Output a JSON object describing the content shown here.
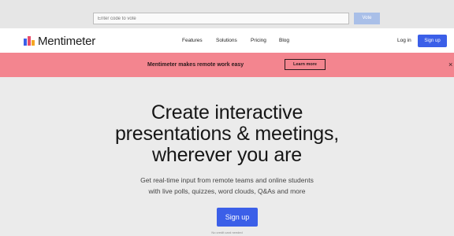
{
  "vote": {
    "placeholder": "Enter code to vote",
    "button_label": "Vote"
  },
  "nav": {
    "brand": "Mentimeter",
    "links": [
      "Features",
      "Solutions",
      "Pricing",
      "Blog"
    ],
    "login": "Log in",
    "signup": "Sign up"
  },
  "banner": {
    "text": "Mentimeter makes remote work easy",
    "learn_more": "Learn more",
    "close_glyph": "×"
  },
  "hero": {
    "headline": [
      "Create interactive",
      "presentations & meetings,",
      "wherever you are"
    ],
    "subtext": [
      "Get real-time input from remote teams and online students",
      "with live polls, quizzes, word clouds, Q&As and more"
    ],
    "cta": "Sign up",
    "note": "No credit card needed"
  },
  "colors": {
    "brand_blue": "#3b5fe8",
    "banner_pink": "#f3858f"
  }
}
